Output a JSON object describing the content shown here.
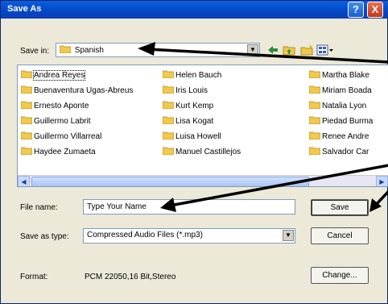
{
  "window": {
    "title": "Save As"
  },
  "titlebar": {
    "help_glyph": "?",
    "close_glyph": "X"
  },
  "save_in": {
    "label": "Save in:",
    "value": "Spanish"
  },
  "toolbar_icons": [
    "back-icon",
    "up-folder-icon",
    "new-folder-icon",
    "views-icon"
  ],
  "files": {
    "col1": [
      "Andrea Reyes",
      "Buenaventura Ugas-Abreus",
      "Ernesto Aponte",
      "Guillermo Labrit",
      "Guillermo Villarreal",
      "Haydee Zumaeta"
    ],
    "col2": [
      "Helen Bauch",
      "Iris Louis",
      "Kurt Kemp",
      "Lisa Kogat",
      "Luisa Howell",
      "Manuel Castillejos"
    ],
    "col3": [
      "Martha Blake",
      "Miriam Boada",
      "Natalia Lyon",
      "Piedad Burma",
      "Renee Andre",
      "Salvador Car"
    ],
    "selected": "Andrea Reyes"
  },
  "file_name": {
    "label": "File name:",
    "value": "Type Your Name"
  },
  "save_as_type": {
    "label": "Save as type:",
    "value": "Compressed Audio Files (*.mp3)"
  },
  "format": {
    "label": "Format:",
    "value": "PCM 22050,16 Bit,Stereo"
  },
  "buttons": {
    "save": "Save",
    "cancel": "Cancel",
    "change": "Change..."
  },
  "colors": {
    "titlebar": "#0447c6",
    "dialog_bg": "#ece9d8",
    "folder": "#f2c94c",
    "arrow": "#000000"
  }
}
